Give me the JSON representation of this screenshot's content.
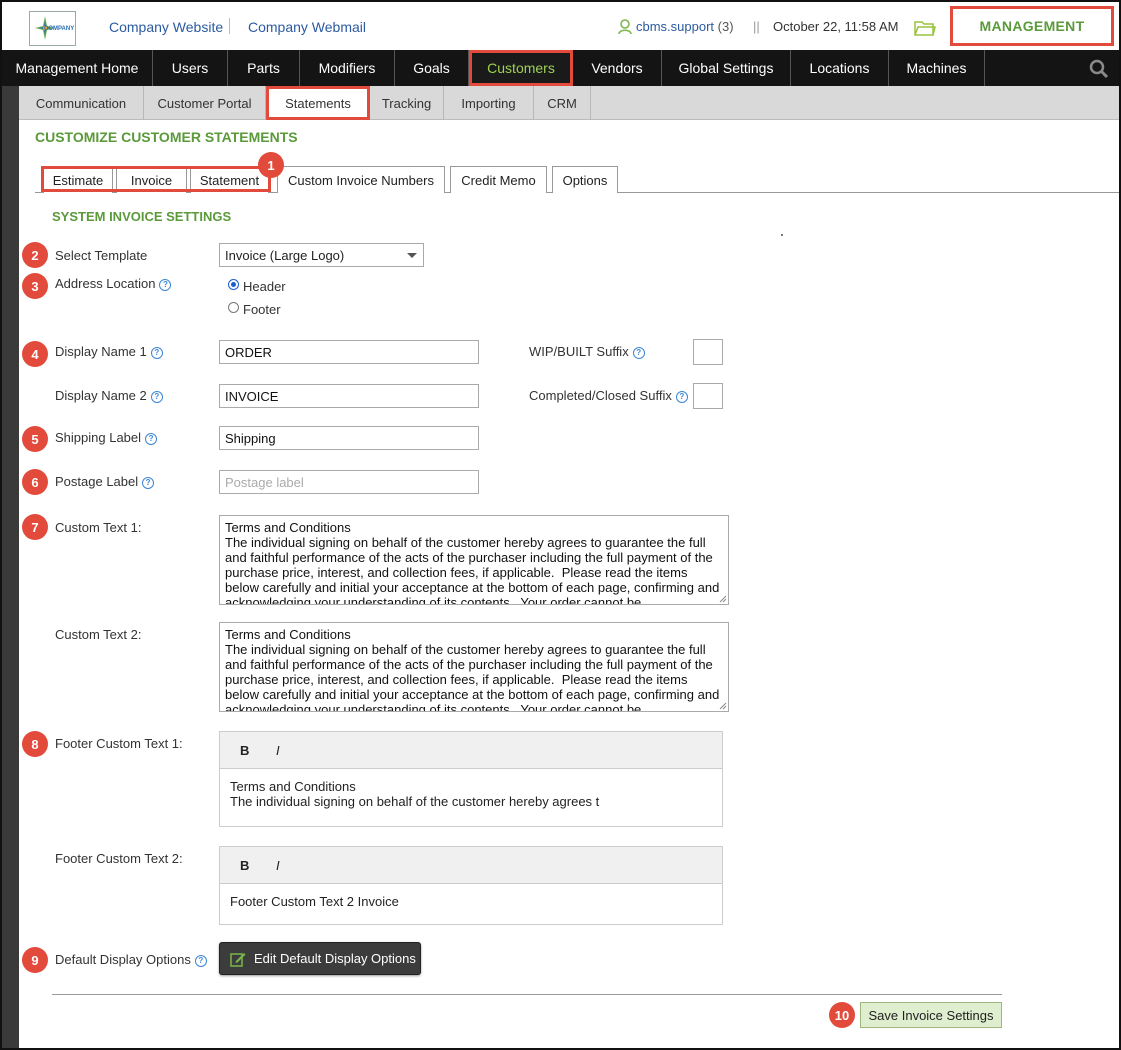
{
  "colors": {
    "accent_green": "#5a9a3a",
    "nav_active": "#9fd154",
    "highlight_red": "#e24b3b",
    "nav_bg": "#141414"
  },
  "topbar": {
    "logo_text": "COMPANY",
    "links": [
      "Company Website",
      "Company Webmail"
    ],
    "user": "cbms.support",
    "user_count": "(3)",
    "separator": "||",
    "datetime": "October 22, 11:58 AM",
    "management": "MANAGEMENT"
  },
  "mainnav": {
    "items": [
      "Management Home",
      "Users",
      "Parts",
      "Modifiers",
      "Goals",
      "Customers",
      "Vendors",
      "Global Settings",
      "Locations",
      "Machines"
    ],
    "active": "Customers"
  },
  "subnav": {
    "items": [
      "Communication",
      "Customer Portal",
      "Statements",
      "Tracking",
      "Importing",
      "CRM"
    ],
    "active": "Statements"
  },
  "page_title": "CUSTOMIZE CUSTOMER STATEMENTS",
  "tabs": [
    "Estimate",
    "Invoice",
    "Statement",
    "Custom Invoice Numbers",
    "Credit Memo",
    "Options"
  ],
  "section_title": "SYSTEM INVOICE SETTINGS",
  "badges": [
    "1",
    "2",
    "3",
    "4",
    "5",
    "6",
    "7",
    "8",
    "9",
    "10"
  ],
  "help_glyph": "?",
  "form": {
    "select_template": {
      "label": "Select Template",
      "value": "Invoice (Large Logo)"
    },
    "address_location": {
      "label": "Address Location",
      "options": [
        "Header",
        "Footer"
      ],
      "selected": "Header"
    },
    "display_name_1": {
      "label": "Display Name 1",
      "value": "ORDER"
    },
    "display_name_2": {
      "label": "Display Name 2",
      "value": "INVOICE"
    },
    "wip_suffix": {
      "label": "WIP/BUILT Suffix",
      "value": ""
    },
    "completed_suffix": {
      "label": "Completed/Closed Suffix",
      "value": ""
    },
    "shipping_label": {
      "label": "Shipping Label",
      "value": "Shipping"
    },
    "postage_label": {
      "label": "Postage Label",
      "placeholder": "Postage label"
    },
    "custom_text_1": {
      "label": "Custom Text 1:",
      "value": "Terms and Conditions\nThe individual signing on behalf of the customer hereby agrees to guarantee the full and faithful performance of the acts of the purchaser including the full payment of the purchase price, interest, and collection fees, if applicable.  Please read the items below carefully and initial your acceptance at the bottom of each page, confirming and acknowledging your understanding of its contents.  Your order cannot be"
    },
    "custom_text_2": {
      "label": "Custom Text 2:",
      "value": "Terms and Conditions\nThe individual signing on behalf of the customer hereby agrees to guarantee the full and faithful performance of the acts of the purchaser including the full payment of the purchase price, interest, and collection fees, if applicable.  Please read the items below carefully and initial your acceptance at the bottom of each page, confirming and acknowledging your understanding of its contents.  Your order cannot be"
    },
    "footer_custom_text_1": {
      "label": "Footer Custom Text 1:",
      "value": "Terms and Conditions\nThe individual signing on behalf of the customer hereby agrees t"
    },
    "footer_custom_text_2": {
      "label": "Footer Custom Text 2:",
      "value": "Footer Custom Text 2 Invoice"
    },
    "editor_bold": "B",
    "editor_italic": "I",
    "default_display_options": {
      "label": "Default Display Options",
      "button": "Edit Default Display Options"
    },
    "save_button": "Save Invoice Settings"
  }
}
